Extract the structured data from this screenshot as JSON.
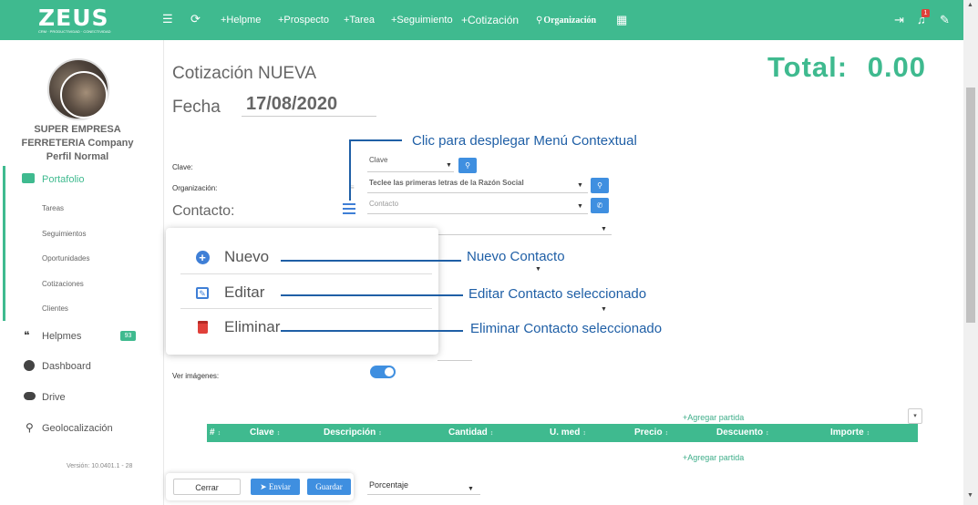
{
  "topbar": {
    "logo_text": "ZEUS",
    "logo_tagline": "CRM · PRODUCTIVIDAD · CONECTIVIDAD",
    "menu_icon": "hamburger-icon",
    "refresh_icon": "refresh-icon",
    "links": [
      "+Helpme",
      "+Prospecto",
      "+Tarea",
      "+Seguimiento",
      "+Cotización",
      "Organización"
    ],
    "calendar_icon": "calendar-icon",
    "logout_icon": "logout-icon",
    "notifications_count": "1",
    "settings_icon": "wrench-icon"
  },
  "sidebar": {
    "company_line1": "SUPER EMPRESA",
    "company_line2": "FERRETERIA Company",
    "profile": "Perfil Normal",
    "portafolio": "Portafolio",
    "sub_items": [
      "Tareas",
      "Seguimientos",
      "Oportunidades",
      "Cotizaciones",
      "Clientes"
    ],
    "helpmes": "Helpmes",
    "helpmes_badge": "93",
    "dashboard": "Dashboard",
    "drive": "Drive",
    "geolocalizacion": "Geolocalización",
    "version": "Versión: 10.0401.1 - 28"
  },
  "main": {
    "title": "Cotización NUEVA",
    "fecha_label": "Fecha",
    "fecha_value": "17/08/2020",
    "total_label": "Total:",
    "total_value": "0.00",
    "clave_label": "Clave:",
    "clave_select": "Clave",
    "organizacion_label": "Organización:",
    "organizacion_placeholder": "Teclee las primeras letras de la Razón Social",
    "contacto_label": "Contacto:",
    "contacto_placeholder": "Contacto",
    "ver_imagenes_label": "Ver imágenes:",
    "agregar_partida": "+Agregar partida",
    "grid_columns": [
      "#",
      "Clave",
      "Descripción",
      "Cantidad",
      "U. med",
      "Precio",
      "Descuento",
      "Importe"
    ]
  },
  "popup": {
    "nuevo": "Nuevo",
    "editar": "Editar",
    "eliminar": "Eliminar"
  },
  "annotations": {
    "menu": "Clic para desplegar Menú Contextual",
    "nuevo": "Nuevo Contacto",
    "editar": "Editar Contacto seleccionado",
    "eliminar": "Eliminar  Contacto seleccionado"
  },
  "footer": {
    "cerrar": "Cerrar",
    "enviar": "Enviar",
    "guardar": "Guardar",
    "porcentaje": "Porcentaje"
  },
  "colors": {
    "brand_green": "#3fba8f",
    "button_blue": "#3f8fe0",
    "annotation_blue": "#1f5fa6",
    "delete_red": "#e0403a"
  }
}
